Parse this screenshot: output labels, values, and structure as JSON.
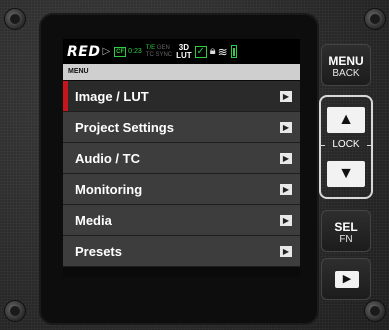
{
  "status_bar": {
    "logo": "RED",
    "play_glyph": "▷",
    "media_label": "CF",
    "media_time": "0:23",
    "te_label": "T/E",
    "gen_label": "GEN",
    "tc_label": "TC",
    "sync_label": "SYNC",
    "lut_top": "3D",
    "lut_bottom": "LUT",
    "check_glyph": "✓",
    "lock_glyph": "🔒︎",
    "wifi_glyph": "≋",
    "battery_color": "#2ecc40"
  },
  "menu": {
    "title": "MENU",
    "items": [
      {
        "label": "Image / LUT",
        "selected": true
      },
      {
        "label": "Project Settings"
      },
      {
        "label": "Audio / TC"
      },
      {
        "label": "Monitoring"
      },
      {
        "label": "Media"
      },
      {
        "label": "Presets"
      }
    ],
    "arrow_glyph": "▶",
    "selection_color": "#c4161c"
  },
  "buttons": {
    "menu_label": "MENU",
    "back_label": "BACK",
    "up_glyph": "▲",
    "lock_label": "LOCK",
    "down_glyph": "▼",
    "sel_label": "SEL",
    "fn_label": "FN",
    "play_glyph": "▶"
  }
}
